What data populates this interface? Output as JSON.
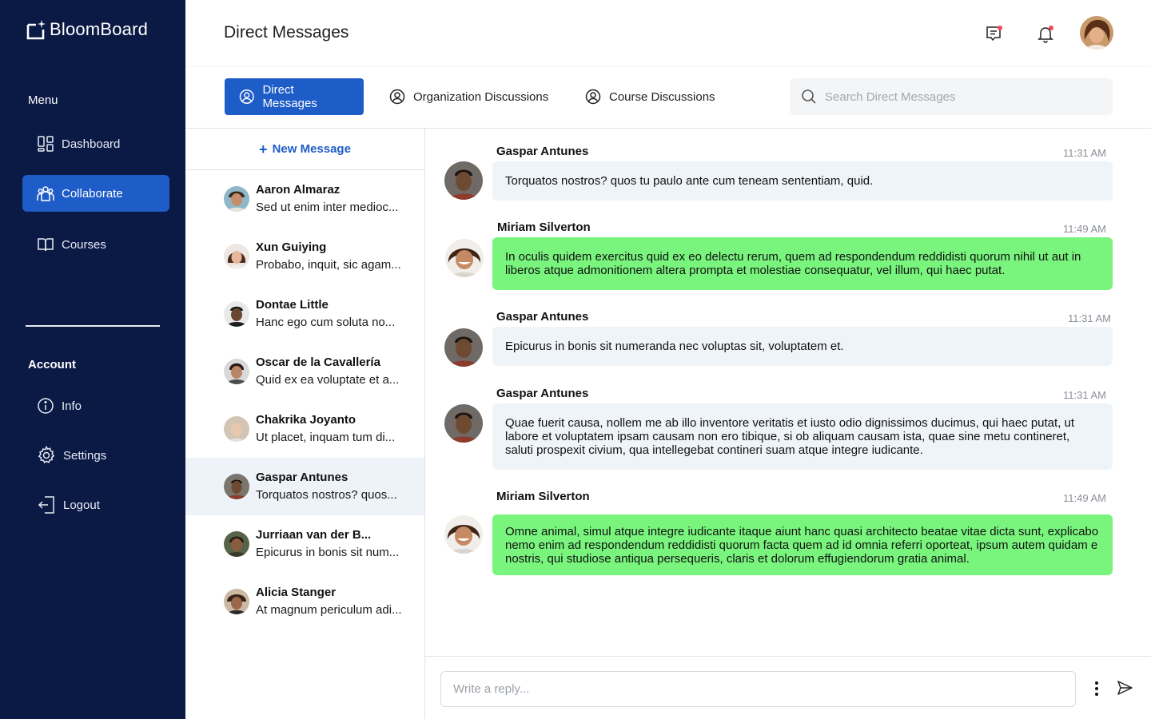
{
  "app": {
    "name": "BloomBoard"
  },
  "sidebar": {
    "menu_heading": "Menu",
    "menu_items": [
      {
        "label": "Dashboard",
        "icon": "dashboard-icon"
      },
      {
        "label": "Collaborate",
        "icon": "collaborate-icon",
        "active": true
      },
      {
        "label": "Courses",
        "icon": "book-icon"
      }
    ],
    "account_heading": "Account",
    "account_items": [
      {
        "label": "Info",
        "icon": "info-icon"
      },
      {
        "label": "Settings",
        "icon": "gear-icon"
      },
      {
        "label": "Logout",
        "icon": "logout-icon"
      }
    ]
  },
  "header": {
    "title": "Direct Messages",
    "icons": [
      "messages-icon",
      "bell-icon"
    ],
    "notification_dot_color": "#ef4a5b"
  },
  "tabs": [
    {
      "label": "Direct Messages",
      "active": true
    },
    {
      "label": "Organization Discussions"
    },
    {
      "label": "Course Discussions"
    }
  ],
  "search": {
    "placeholder": "Search Direct Messages"
  },
  "conversations": {
    "new_message_label": "New Message",
    "items": [
      {
        "name": "Aaron Almaraz",
        "preview": "Sed ut enim inter medioc..."
      },
      {
        "name": "Xun Guiying",
        "preview": "Probabo, inquit, sic agam..."
      },
      {
        "name": "Dontae Little",
        "preview": "Hanc ego cum soluta no..."
      },
      {
        "name": "Oscar de la Cavallería",
        "preview": "Quid ex ea voluptate et a..."
      },
      {
        "name": "Chakrika Joyanto",
        "preview": "Ut placet, inquam tum di..."
      },
      {
        "name": "Gaspar Antunes",
        "preview": "Torquatos nostros? quos...",
        "selected": true
      },
      {
        "name": "Jurriaan van der B...",
        "preview": "Epicurus in bonis sit num..."
      },
      {
        "name": "Alicia Stanger",
        "preview": "At magnum periculum adi..."
      }
    ]
  },
  "messages": [
    {
      "sender": "Gaspar Antunes",
      "time": "11:31 AM",
      "text": "Torquatos nostros? quos tu paulo ante cum teneam sententiam, quid.",
      "style": "gray"
    },
    {
      "sender": "Miriam Silverton",
      "time": "11:49 AM",
      "text": "In oculis quidem exercitus quid ex eo delectu rerum, quem ad respondendum reddidisti quorum nihil ut aut in liberos atque admonitionem altera prompta et molestiae consequatur, vel illum, qui haec putat.",
      "style": "green"
    },
    {
      "sender": "Gaspar Antunes",
      "time": "11:31 AM",
      "text": "Epicurus in bonis sit numeranda nec voluptas sit, voluptatem et.",
      "style": "gray"
    },
    {
      "sender": "Gaspar Antunes",
      "time": "11:31 AM",
      "text": "Quae fuerit causa, nollem me ab illo inventore veritatis et iusto odio dignissimos ducimus, qui haec putat, ut labore et voluptatem ipsam causam non ero tibique, si ob aliquam causam ista, quae sine metu contineret, saluti prospexit civium, qua intellegebat contineri suam atque integre iudicante.",
      "style": "gray"
    },
    {
      "sender": "Miriam Silverton",
      "time": "11:49 AM",
      "text": "Omne animal, simul atque integre iudicante itaque aiunt hanc quasi architecto beatae vitae dicta sunt, explicabo nemo enim ad respondendum reddidisti quorum facta quem ad id omnia referri oporteat, ipsum autem quidam e nostris, qui studiose antiqua persequeris, claris et dolorum effugiendorum gratia  animal.",
      "style": "green"
    }
  ],
  "reply": {
    "placeholder": "Write a reply..."
  },
  "colors": {
    "sidebar_bg": "#0b1a45",
    "accent": "#1e5cc8",
    "incoming_bubble": "#eff4f9",
    "outgoing_bubble": "#79f57e"
  }
}
